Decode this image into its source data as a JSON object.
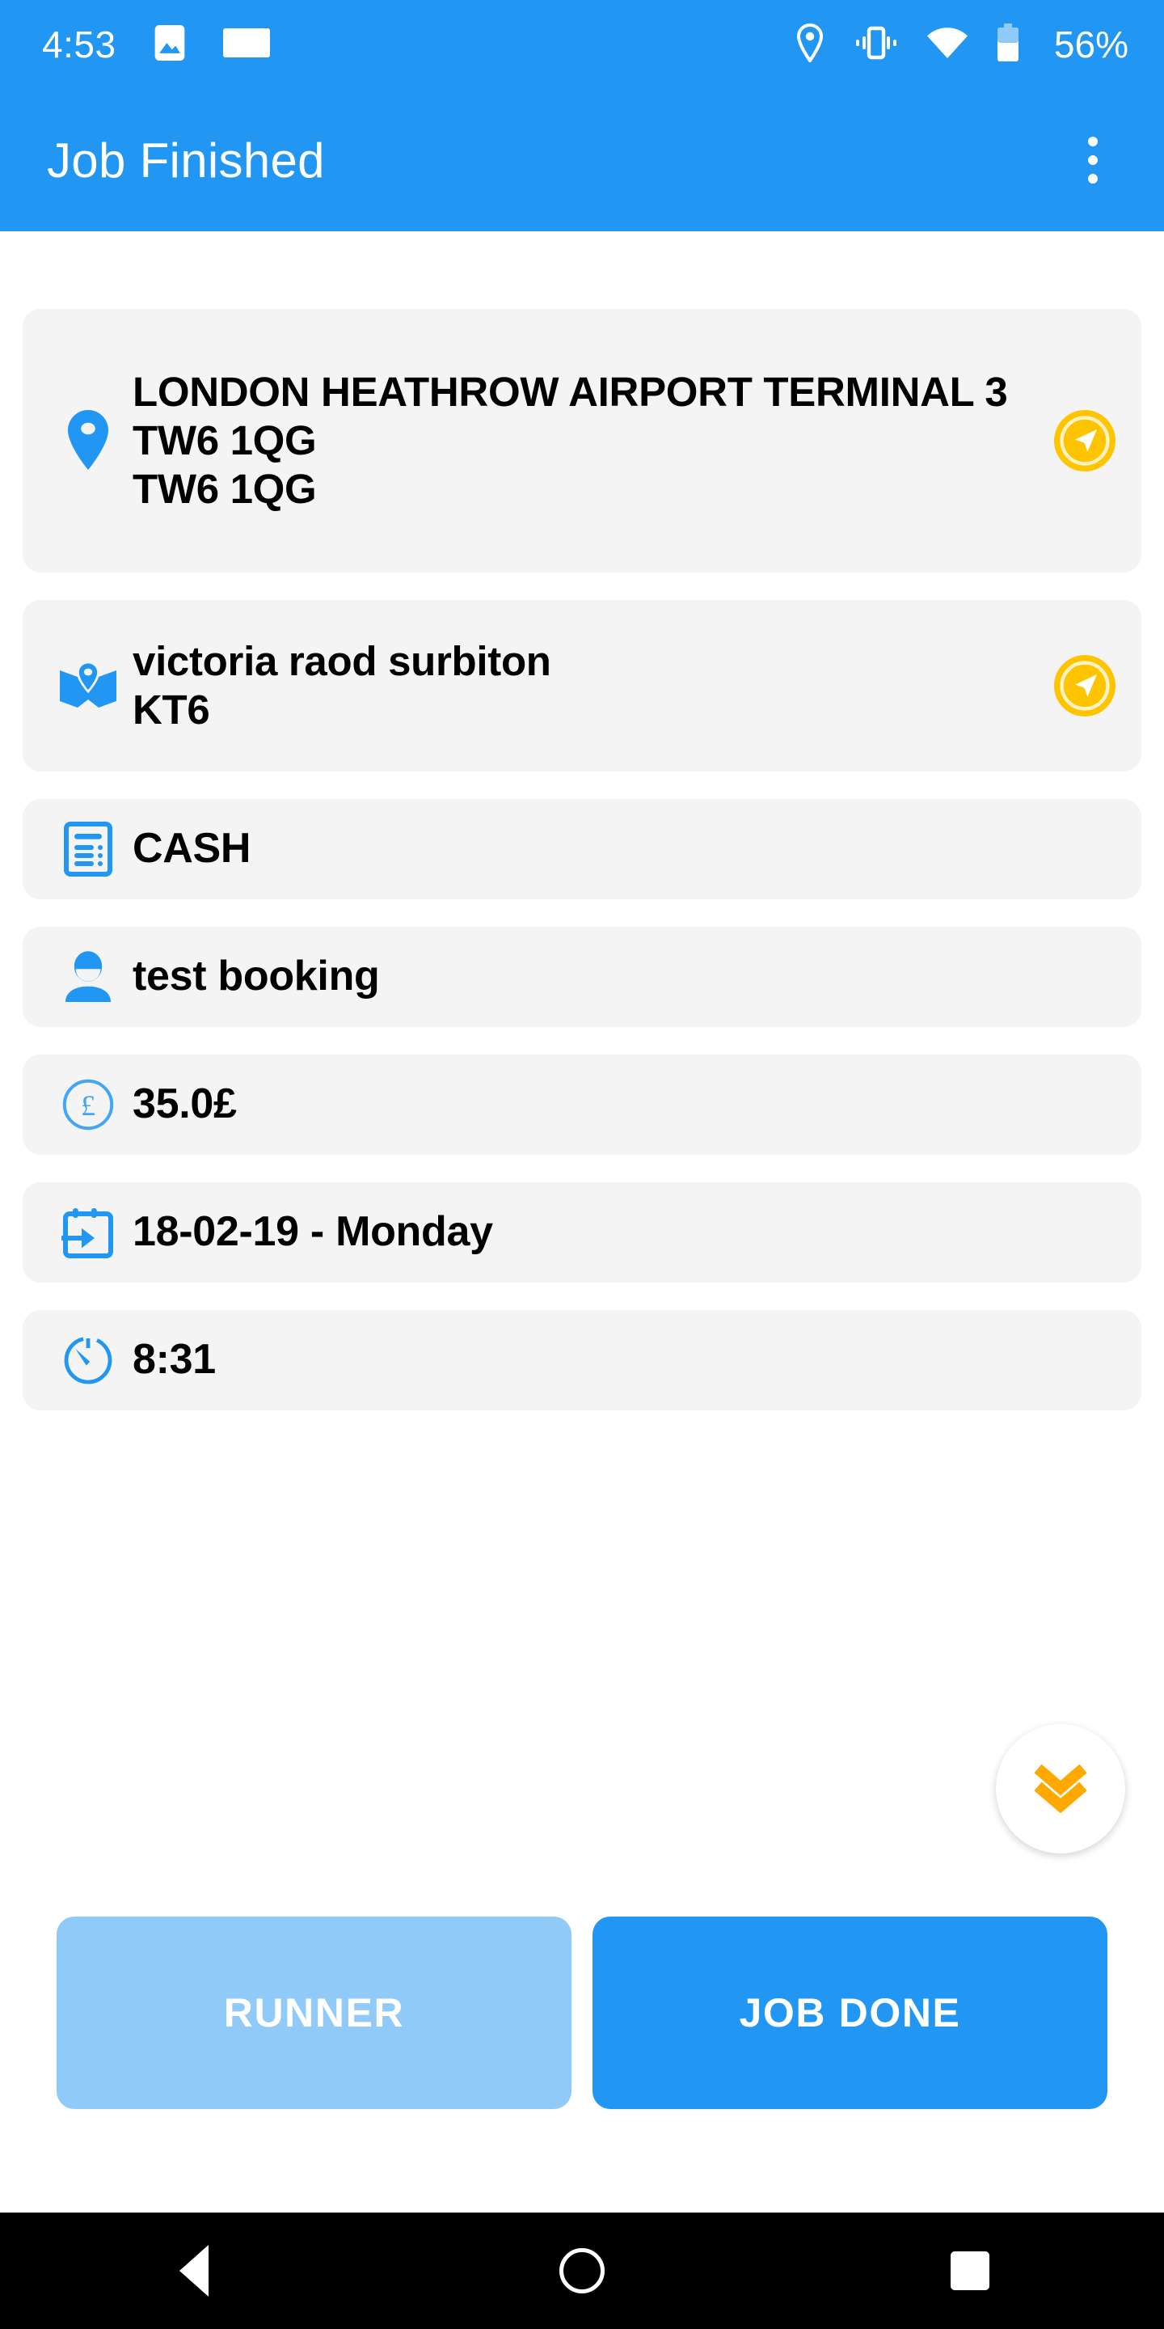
{
  "status_bar": {
    "time": "4:53",
    "battery_percent": "56%",
    "icons": [
      "image-icon",
      "screenshot-icon",
      "location-icon",
      "vibrate-icon",
      "wifi-icon",
      "battery-icon"
    ]
  },
  "app_bar": {
    "title": "Job Finished",
    "overflow_label": "more-options"
  },
  "job": {
    "rows": [
      {
        "icon": "location-pin-icon",
        "text": "LONDON HEATHROW AIRPORT TERMINAL 3 TW6 1QG\nTW6 1QG",
        "action_icon": "navigate-icon",
        "name": "pickup-address"
      },
      {
        "icon": "map-pin-icon",
        "text": "victoria raod surbiton\nKT6",
        "action_icon": "navigate-icon",
        "name": "dropoff-address"
      },
      {
        "icon": "receipt-icon",
        "text": "CASH",
        "name": "payment-method"
      },
      {
        "icon": "person-icon",
        "text": "test booking",
        "name": "passenger-name"
      },
      {
        "icon": "pound-circle-icon",
        "text": "35.0£",
        "name": "fare-amount"
      },
      {
        "icon": "calendar-arrow-icon",
        "text": "18-02-19 - Monday",
        "name": "job-date"
      },
      {
        "icon": "stopwatch-icon",
        "text": "8:31",
        "name": "job-time"
      }
    ]
  },
  "scroll_fab": {
    "icon": "double-chevron-down-icon"
  },
  "actions": {
    "runner_label": "RUNNER",
    "job_done_label": "JOB DONE"
  },
  "nav_bar": {
    "back": "back-button",
    "home": "home-button",
    "recents": "recents-button"
  },
  "colors": {
    "primary": "#2196F3",
    "primary_light": "#90CAF9",
    "accent_yellow": "#FFC107",
    "accent_orange": "#FFA800",
    "card_bg": "#F4F4F4"
  }
}
